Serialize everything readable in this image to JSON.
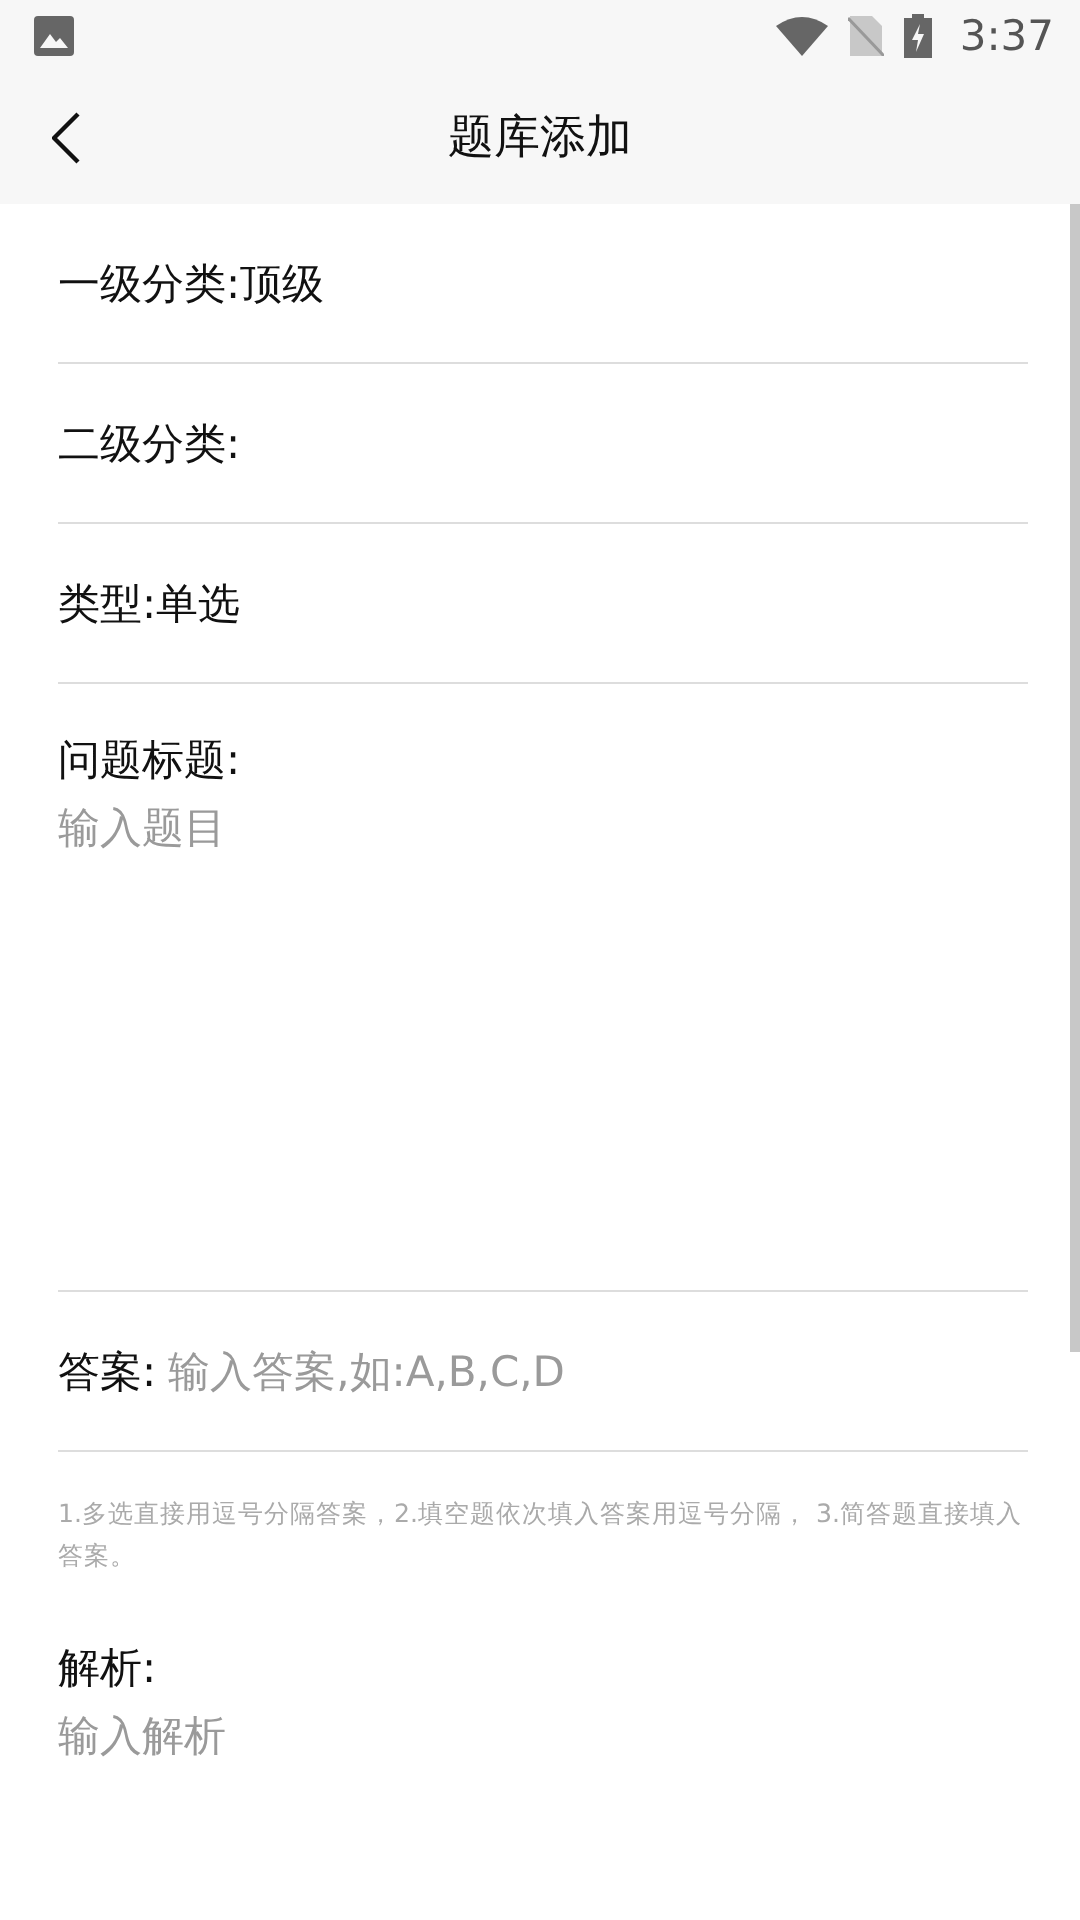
{
  "status_bar": {
    "time": "3:37"
  },
  "app_bar": {
    "title": "题库添加"
  },
  "info_rows": [
    {
      "label": "一级分类:顶级"
    },
    {
      "label": "二级分类:"
    },
    {
      "label": "类型:单选"
    }
  ],
  "question": {
    "label": "问题标题:",
    "placeholder": "输入题目"
  },
  "answer": {
    "label": "答案:",
    "placeholder": "输入答案,如:A,B,C,D"
  },
  "hint": "1.多选直接用逗号分隔答案，2.填空题依次填入答案用逗号分隔， 3.简答题直接填入答案。",
  "analysis": {
    "label": "解析:",
    "placeholder": "输入解析"
  }
}
